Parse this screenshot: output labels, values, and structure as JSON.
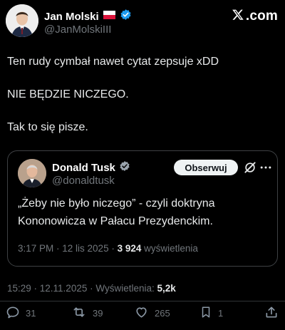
{
  "author": {
    "name": "Jan Molski",
    "handle": "@JanMolskiIII"
  },
  "brand": {
    "logo_text": ".com"
  },
  "post": {
    "lines": [
      "Ten rudy cymbał nawet cytat zepsuje xDD",
      "NIE BĘDZIE NICZEGO.",
      "Tak to się pisze."
    ],
    "timestamp": "15:29 · 12.11.2025 · ",
    "views_label": "Wyświetlenia: ",
    "views_value": "5,2k"
  },
  "quoted": {
    "name": "Donald Tusk",
    "handle": "@donaldtusk",
    "follow_label": "Obserwuj",
    "text_lines": [
      "„Żeby nie było niczego” - czyli doktryna",
      "Kononowicza w Pałacu Prezydenckim."
    ],
    "timestamp": "3:17 PM · 12 lis 2025 · ",
    "views_value": "3 924",
    "views_label": " wyświetlenia"
  },
  "actions": {
    "replies": "31",
    "reposts": "39",
    "likes": "265",
    "bookmarks": "1"
  },
  "colors": {
    "background": "#000000",
    "text": "#e7e9ea",
    "muted": "#71767b",
    "verified": "#1d9bf0",
    "border": "#3e4144"
  },
  "icons": [
    "polish-flag-icon",
    "verified-badge-icon",
    "x-logo-icon",
    "grok-icon",
    "more-icon",
    "reply-icon",
    "repost-icon",
    "like-icon",
    "bookmark-icon",
    "share-icon"
  ]
}
